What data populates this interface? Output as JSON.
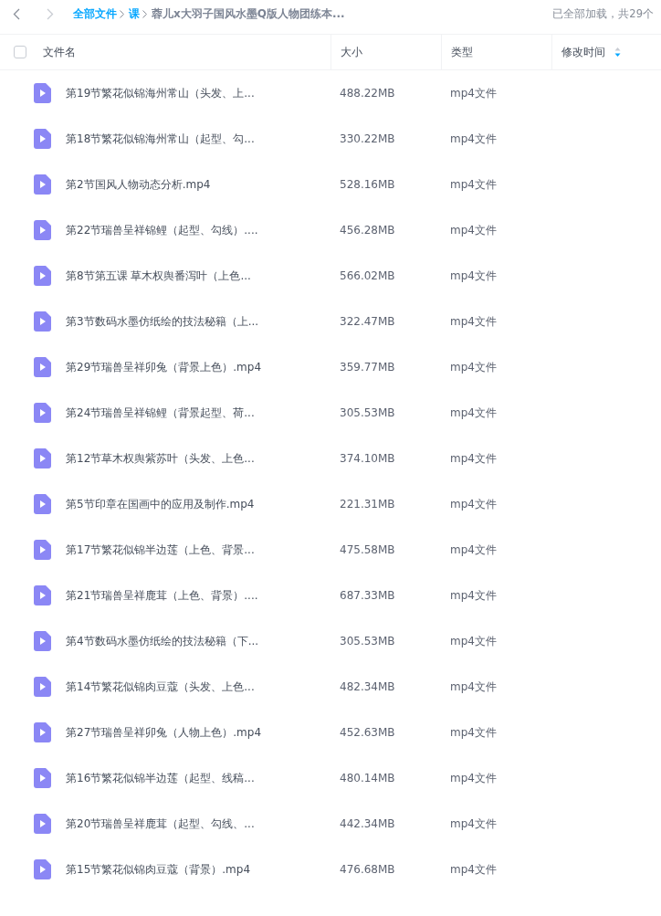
{
  "nav": {
    "back": {
      "disabled": false
    },
    "forward": {
      "disabled": true
    }
  },
  "breadcrumb": [
    {
      "label": "全部文件",
      "current": false
    },
    {
      "label": "课",
      "current": false
    },
    {
      "label": "蓉儿x大羽子国风水墨Q版人物团练本...",
      "current": true
    }
  ],
  "load_status": "已全部加载，共29个",
  "table": {
    "select_all": {
      "checked": false
    },
    "columns": [
      {
        "label": "文件名",
        "sorted": false
      },
      {
        "label": "大小",
        "sorted": false
      },
      {
        "label": "类型",
        "sorted": false
      },
      {
        "label": "修改时间",
        "sorted": true
      }
    ],
    "rows": [
      {
        "name": "第19节繁花似锦海州常山（头发、上...",
        "size": "488.22MB",
        "type": "mp4文件"
      },
      {
        "name": "第18节繁花似锦海州常山（起型、勾...",
        "size": "330.22MB",
        "type": "mp4文件"
      },
      {
        "name": "第2节国风人物动态分析.mp4",
        "size": "528.16MB",
        "type": "mp4文件"
      },
      {
        "name": "第22节瑞兽呈祥锦鲤（起型、勾线）....",
        "size": "456.28MB",
        "type": "mp4文件"
      },
      {
        "name": "第8节第五课 草木权舆番泻叶（上色...",
        "size": "566.02MB",
        "type": "mp4文件"
      },
      {
        "name": "第3节数码水墨仿纸绘的技法秘籍（上...",
        "size": "322.47MB",
        "type": "mp4文件"
      },
      {
        "name": "第29节瑞兽呈祥卯兔（背景上色）.mp4",
        "size": "359.77MB",
        "type": "mp4文件"
      },
      {
        "name": "第24节瑞兽呈祥锦鲤（背景起型、荷...",
        "size": "305.53MB",
        "type": "mp4文件"
      },
      {
        "name": "第12节草木权舆紫苏叶（头发、上色...",
        "size": "374.10MB",
        "type": "mp4文件"
      },
      {
        "name": "第5节印章在国画中的应用及制作.mp4",
        "size": "221.31MB",
        "type": "mp4文件"
      },
      {
        "name": "第17节繁花似锦半边莲（上色、背景...",
        "size": "475.58MB",
        "type": "mp4文件"
      },
      {
        "name": "第21节瑞兽呈祥鹿茸（上色、背景）....",
        "size": "687.33MB",
        "type": "mp4文件"
      },
      {
        "name": "第4节数码水墨仿纸绘的技法秘籍（下...",
        "size": "305.53MB",
        "type": "mp4文件"
      },
      {
        "name": "第14节繁花似锦肉豆蔻（头发、上色...",
        "size": "482.34MB",
        "type": "mp4文件"
      },
      {
        "name": "第27节瑞兽呈祥卯兔（人物上色）.mp4",
        "size": "452.63MB",
        "type": "mp4文件"
      },
      {
        "name": "第16节繁花似锦半边莲（起型、线稿...",
        "size": "480.14MB",
        "type": "mp4文件"
      },
      {
        "name": "第20节瑞兽呈祥鹿茸（起型、勾线、...",
        "size": "442.34MB",
        "type": "mp4文件"
      },
      {
        "name": "第15节繁花似锦肉豆蔻（背景）.mp4",
        "size": "476.68MB",
        "type": "mp4文件"
      }
    ]
  }
}
